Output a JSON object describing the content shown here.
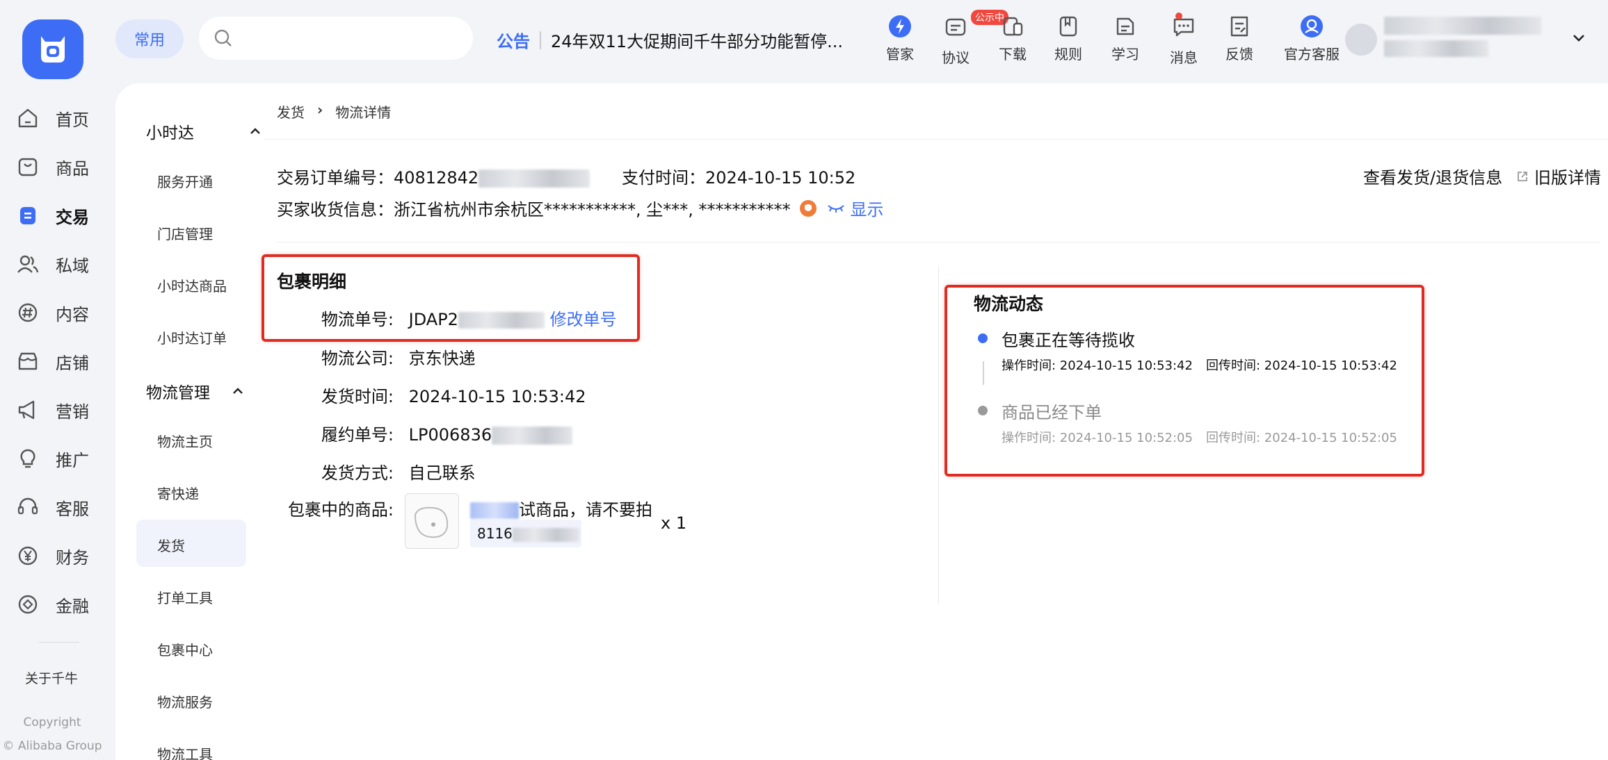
{
  "app": {
    "logo_icon": "app-logo-icon"
  },
  "nav": [
    {
      "label": "首页",
      "icon": "home-icon"
    },
    {
      "label": "商品",
      "icon": "product-icon"
    },
    {
      "label": "交易",
      "icon": "trade-icon",
      "active": true
    },
    {
      "label": "私域",
      "icon": "users-icon"
    },
    {
      "label": "内容",
      "icon": "content-icon"
    },
    {
      "label": "店铺",
      "icon": "store-icon"
    },
    {
      "label": "营销",
      "icon": "megaphone-icon"
    },
    {
      "label": "推广",
      "icon": "bulb-icon"
    },
    {
      "label": "客服",
      "icon": "headset-icon"
    },
    {
      "label": "财务",
      "icon": "yuan-icon"
    },
    {
      "label": "金融",
      "icon": "finance-icon"
    }
  ],
  "footer": {
    "about": "关于千牛",
    "copyright": "Copyright",
    "company": "© Alibaba Group"
  },
  "topbar": {
    "pill": "常用",
    "search_value": "",
    "notice_tag": "公告",
    "notice_text": "24年双11大促期间千牛部分功能暂停...",
    "tools": [
      {
        "label": "管家",
        "icon": "lightning-icon"
      },
      {
        "label": "协议",
        "icon": "agreement-icon",
        "badge": "公示中"
      },
      {
        "label": "下载",
        "icon": "download-device-icon"
      },
      {
        "label": "规则",
        "icon": "rules-book-icon"
      },
      {
        "label": "学习",
        "icon": "learn-icon"
      },
      {
        "label": "消息",
        "icon": "message-icon",
        "dot": true
      },
      {
        "label": "反馈",
        "icon": "feedback-icon"
      },
      {
        "label": "官方客服",
        "icon": "official-service-icon"
      }
    ]
  },
  "subnav": {
    "group1": "小时达",
    "group1_items": [
      "服务开通",
      "门店管理",
      "小时达商品",
      "小时达订单"
    ],
    "group2": "物流管理",
    "group2_items": [
      "物流主页",
      "寄快递",
      "发货",
      "打单工具",
      "包裹中心",
      "物流服务",
      "物流工具"
    ],
    "active": "发货"
  },
  "breadcrumb": {
    "parent": "发货",
    "sep": "›",
    "current": "物流详情"
  },
  "order": {
    "order_no_label": "交易订单编号：",
    "order_no": "40812842",
    "pay_time_label": "支付时间：",
    "pay_time": "2024-10-15 10:52",
    "buyer_label": "买家收货信息：",
    "buyer_info": "浙江省杭州市余杭区***********, 尘***, ***********",
    "show_link": "显示",
    "view_link": "查看发货/退货信息",
    "old_link": "旧版详情"
  },
  "package": {
    "title": "包裹明细",
    "tracking_label": "物流单号:",
    "tracking_no": "JDAP2",
    "edit_link": "修改单号",
    "company_label": "物流公司:",
    "company": "京东快递",
    "ship_time_label": "发货时间:",
    "ship_time": "2024-10-15 10:53:42",
    "fulfil_label": "履约单号:",
    "fulfil_no": "LP006836",
    "method_label": "发货方式:",
    "method": "自己联系",
    "goods_label": "包裹中的商品:",
    "goods_name": "试商品，请不要拍",
    "goods_code": "8116",
    "qty": "x 1"
  },
  "logistics": {
    "title": "物流动态",
    "events": [
      {
        "status": "包裹正在等待揽收",
        "op": "操作时间: 2024-10-15 10:53:42",
        "ret": "回传时间: 2024-10-15 10:53:42",
        "current": true
      },
      {
        "status": "商品已经下单",
        "op": "操作时间: 2024-10-15 10:52:05",
        "ret": "回传时间: 2024-10-15 10:52:05",
        "current": false
      }
    ]
  },
  "colors": {
    "accent": "#3d6df5",
    "highlight_box": "#e02b22",
    "badge": "#f0483e"
  }
}
